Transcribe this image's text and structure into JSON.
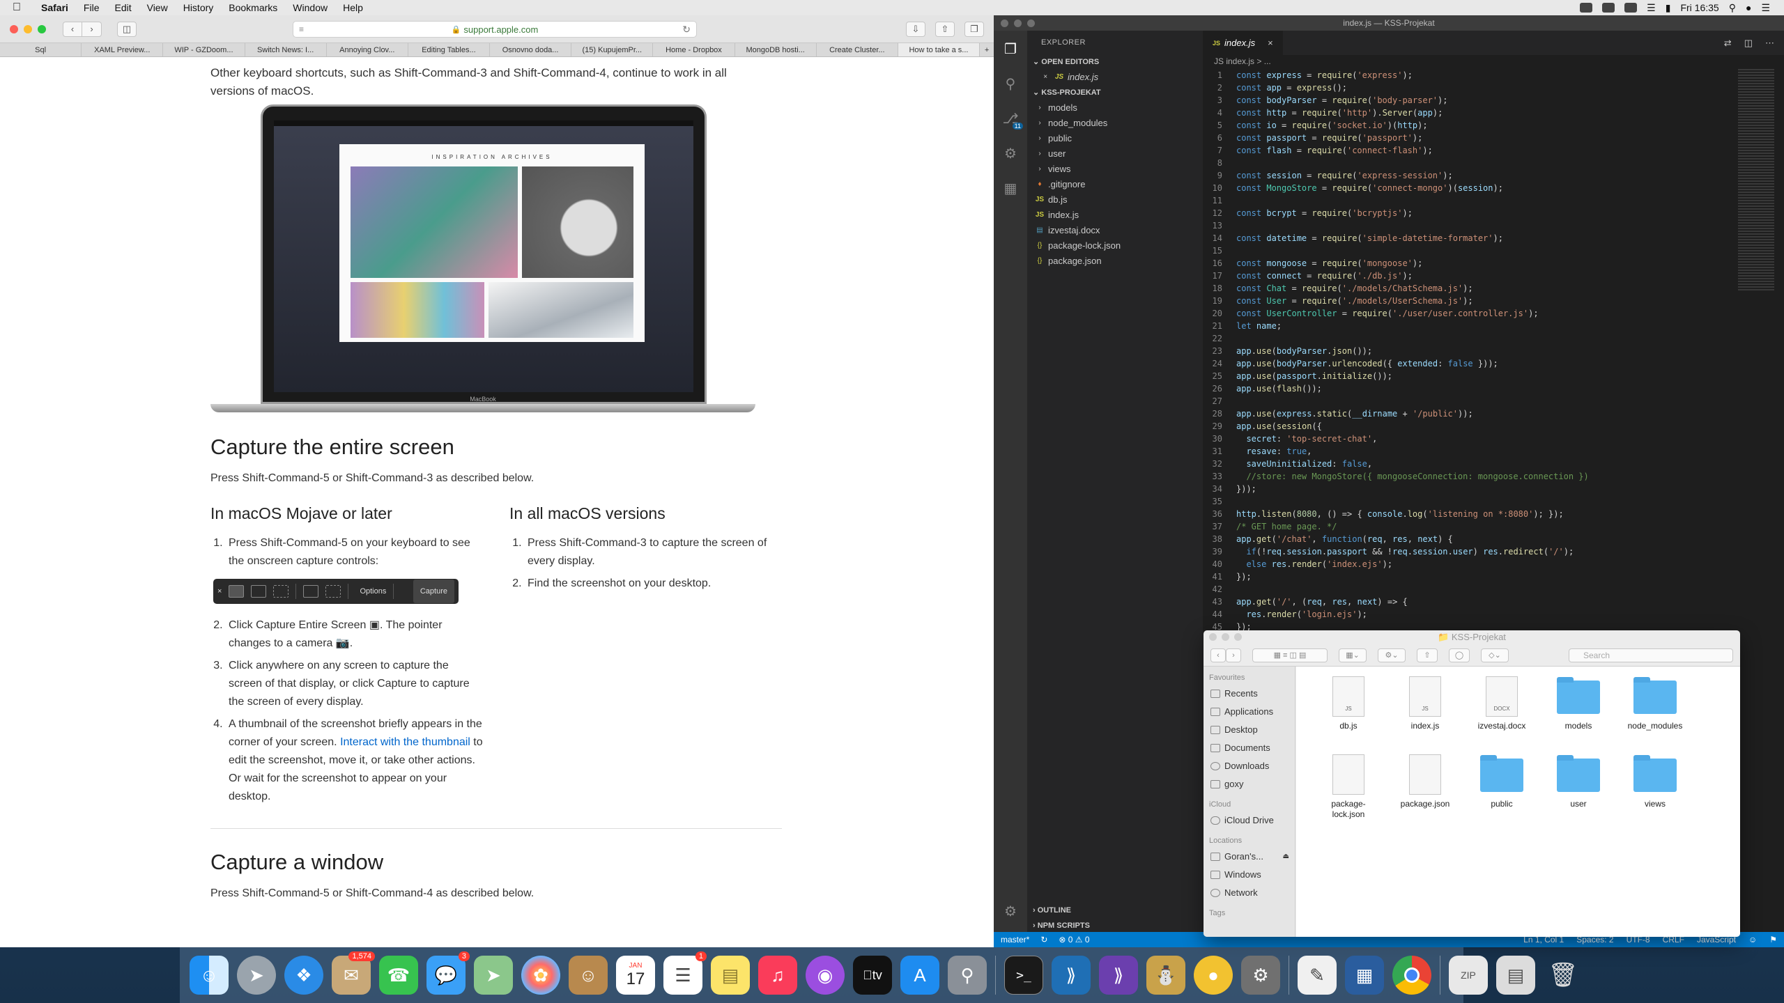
{
  "menubar": {
    "app": "Safari",
    "items": [
      "File",
      "Edit",
      "View",
      "History",
      "Bookmarks",
      "Window",
      "Help"
    ],
    "clock": "Fri 16:35"
  },
  "safari": {
    "url": "support.apple.com",
    "tabs": [
      "Sql",
      "XAML Preview...",
      "WIP - GZDoom...",
      "Switch News: I...",
      "Annoying Clov...",
      "Editing Tables...",
      "Osnovno doda...",
      "(15) KupujemPr...",
      "Home - Dropbox",
      "MongoDB hosti...",
      "Create Cluster...",
      "How to take a s..."
    ],
    "article": {
      "intro": "Other keyboard shortcuts, such as Shift-Command-3 and Shift-Command-4, continue to work in all versions of macOS.",
      "laptop_brand": "MacBook",
      "laptop_site_title": "INSPIRATION ARCHIVES",
      "h_entire": "Capture the entire screen",
      "p_entire": "Press Shift-Command-5 or Shift-Command-3 as described below.",
      "col1_title": "In macOS Mojave or later",
      "col1_steps": {
        "s1": "Press Shift-Command-5 on your keyboard to see the onscreen capture controls:",
        "s2a": "Click Capture Entire Screen ",
        "s2b": ". The pointer changes to a camera ",
        "s3": "Click anywhere on any screen to capture the screen of that display, or click Capture to capture the screen of every display.",
        "s4a": "A thumbnail of the screenshot briefly appears in the corner of your screen. ",
        "s4link": "Interact with the thumbnail",
        "s4b": " to edit the screenshot, move it, or take other actions. Or wait for the screenshot to appear on your desktop."
      },
      "capbar_options": "Options",
      "capbar_capture": "Capture",
      "col2_title": "In all macOS versions",
      "col2_steps": {
        "s1": "Press Shift-Command-3 to capture the screen of every display.",
        "s2": "Find the screenshot on your desktop."
      },
      "h_window": "Capture a window",
      "p_window": "Press Shift-Command-5 or Shift-Command-4 as described below."
    }
  },
  "vscode": {
    "title": "index.js — KSS-Projekat",
    "explorer_label": "EXPLORER",
    "open_editors_label": "OPEN EDITORS",
    "open_editor_file": "index.js",
    "project_label": "KSS-PROJEKAT",
    "folders": [
      "models",
      "node_modules",
      "public",
      "user",
      "views"
    ],
    "files": [
      ".gitignore",
      "db.js",
      "index.js",
      "izvestaj.docx",
      "package-lock.json",
      "package.json"
    ],
    "outline_label": "OUTLINE",
    "npm_label": "NPM SCRIPTS",
    "tab": "index.js",
    "breadcrumb": "JS index.js > ...",
    "badge_count": "11",
    "status": {
      "branch": "master*",
      "errors": "⊗ 0 ⚠ 0",
      "position": "Ln 1, Col 1",
      "spaces": "Spaces: 2",
      "encoding": "UTF-8",
      "eol": "CRLF",
      "language": "JavaScript"
    },
    "code": [
      "const express = require('express');",
      "const app = express();",
      "const bodyParser = require('body-parser');",
      "const http = require('http').Server(app);",
      "const io = require('socket.io')(http);",
      "const passport = require('passport');",
      "const flash = require('connect-flash');",
      "",
      "const session = require('express-session');",
      "const MongoStore = require('connect-mongo')(session);",
      "",
      "const bcrypt = require('bcryptjs');",
      "",
      "const datetime = require('simple-datetime-formater');",
      "",
      "const mongoose = require('mongoose');",
      "const connect = require('./db.js');",
      "const Chat = require('./models/ChatSchema.js');",
      "const User = require('./models/UserSchema.js');",
      "const UserController = require('./user/user.controller.js');",
      "let name;",
      "",
      "app.use(bodyParser.json());",
      "app.use(bodyParser.urlencoded({ extended: false }));",
      "app.use(passport.initialize());",
      "app.use(flash());",
      "",
      "app.use(express.static(__dirname + '/public'));",
      "app.use(session({",
      "  secret: 'top-secret-chat',",
      "  resave: true,",
      "  saveUninitialized: false,",
      "  //store: new MongoStore({ mongooseConnection: mongoose.connection })",
      "}));",
      "",
      "http.listen(8080, () => { console.log('listening on *:8080'); });",
      "/* GET home page. */",
      "app.get('/chat', function(req, res, next) {",
      "  if(!req.session.passport && !req.session.user) res.redirect('/');",
      "  else res.render('index.ejs');",
      "});",
      "",
      "app.get('/', (req, res, next) => {",
      "  res.render('login.ejs');",
      "});"
    ]
  },
  "finder": {
    "title": "KSS-Projekat",
    "search_placeholder": "Search",
    "favourites_label": "Favourites",
    "favourites": [
      "Recents",
      "Applications",
      "Desktop",
      "Documents",
      "Downloads",
      "goxy"
    ],
    "icloud_label": "iCloud",
    "icloud": [
      "iCloud Drive"
    ],
    "locations_label": "Locations",
    "locations": [
      "Goran's...",
      "Windows",
      "Network"
    ],
    "tags_label": "Tags",
    "items": [
      {
        "name": "db.js",
        "kind": "doc",
        "ext": "JS"
      },
      {
        "name": "index.js",
        "kind": "doc",
        "ext": "JS"
      },
      {
        "name": "izvestaj.docx",
        "kind": "doc",
        "ext": "DOCX"
      },
      {
        "name": "models",
        "kind": "folder",
        "ext": ""
      },
      {
        "name": "node_modules",
        "kind": "folder",
        "ext": ""
      },
      {
        "name": "package-lock.json",
        "kind": "doc",
        "ext": ""
      },
      {
        "name": "package.json",
        "kind": "doc",
        "ext": ""
      },
      {
        "name": "public",
        "kind": "folder",
        "ext": ""
      },
      {
        "name": "user",
        "kind": "folder",
        "ext": ""
      },
      {
        "name": "views",
        "kind": "folder",
        "ext": ""
      }
    ]
  },
  "dock": {
    "mail_badge": "1,574",
    "messages_badge": "3",
    "reminders_badge": "1",
    "calendar_month": "JAN",
    "calendar_day": "17"
  }
}
